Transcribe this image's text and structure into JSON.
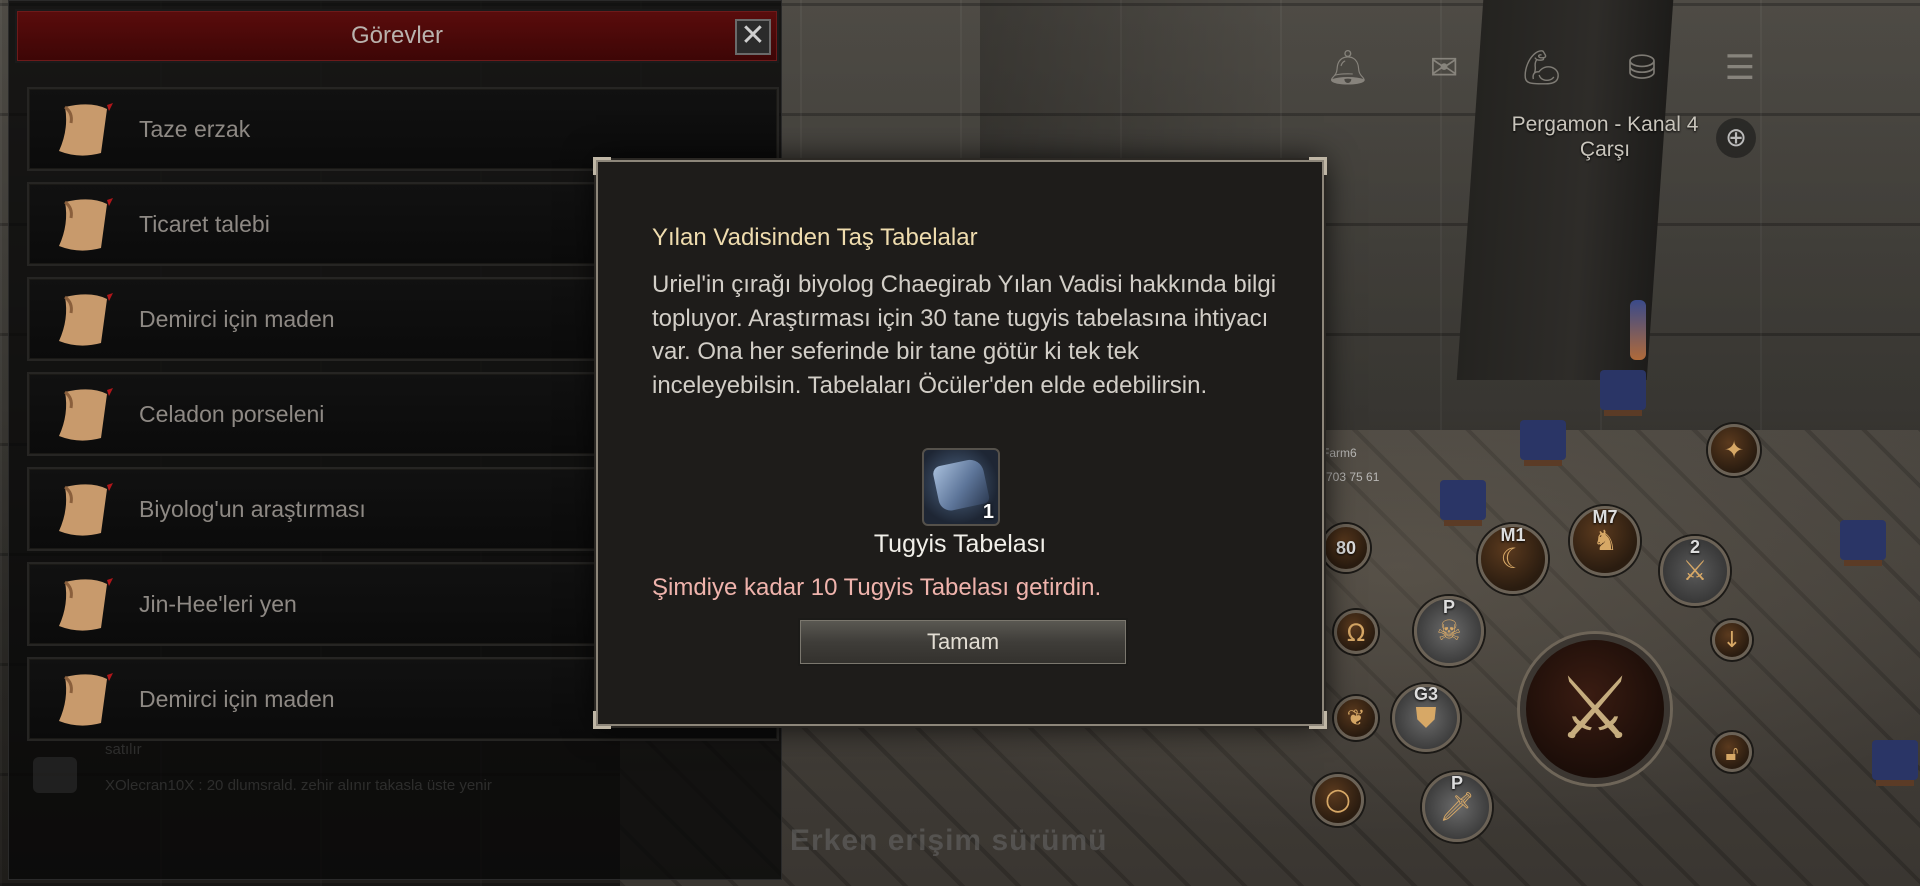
{
  "quest_panel": {
    "title": "Görevler",
    "close_glyph": "✕",
    "items": [
      {
        "label": "Taze erzak",
        "icon": "scroll-icon"
      },
      {
        "label": "Ticaret talebi",
        "icon": "scroll-icon"
      },
      {
        "label": "Demirci için maden",
        "icon": "scroll-icon"
      },
      {
        "label": "Celadon porseleni",
        "icon": "scroll-icon"
      },
      {
        "label": "Biyolog'un araştırması",
        "icon": "scroll-icon"
      },
      {
        "label": "Jin-Hee'leri yen",
        "icon": "scroll-icon"
      },
      {
        "label": "Demirci için maden",
        "icon": "scroll-icon"
      }
    ]
  },
  "chat": {
    "line_seller": "satılır",
    "line_message": "XOlecran10X : 20 dlumsrald. zehir alınır takasla üste yenir"
  },
  "hud": {
    "icons": [
      "bell-icon",
      "mail-icon",
      "strength-icon",
      "backpack-icon",
      "menu-icon"
    ],
    "location_name": "Pergamon - Kanal 4",
    "location_area": "Çarşı",
    "globe_glyph": "⊕"
  },
  "world": {
    "player_name": "Farm6",
    "player_info": "703 75 61",
    "early_access_text": "Erken erişim sürümü"
  },
  "skills": {
    "level_badge": "80",
    "m1_tag": "M1",
    "m7_tag": "M7",
    "slot2_tag": "2",
    "p_tag": "P",
    "g3_tag": "G3",
    "p2_tag": "P"
  },
  "modal": {
    "title": "Yılan Vadisinden Taş Tabelalar",
    "body": "Uriel'in çırağı biyolog Chaegirab Yılan Vadisi hakkında bilgi topluyor. Araştırması için 30 tane tugyis tabelasına ihtiyacı var. Ona her seferinde bir tane götür ki tek tek inceleyebilsin. Tabelaları Öcüler'den elde edebilirsin.",
    "reward": {
      "name": "Tugyis Tabelası",
      "quantity": "1"
    },
    "progress_text": "Şimdiye kadar 10 Tugyis Tabelası getirdin.",
    "ok_label": "Tamam"
  },
  "colors": {
    "header_red": "#5a0c0c",
    "modal_title": "#efdcae",
    "progress_text": "#efb3ac"
  }
}
